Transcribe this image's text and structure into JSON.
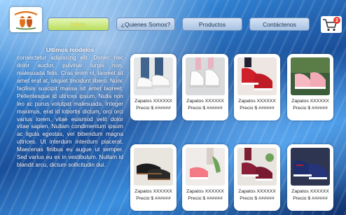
{
  "header": {
    "logo_icon": "sandal-footprint-logo",
    "nav": [
      {
        "label": "Inicio",
        "active": true
      },
      {
        "label": "¿Quienes Somos?",
        "active": false
      },
      {
        "label": "Productos",
        "active": false
      },
      {
        "label": "Contáctenos",
        "active": false
      }
    ],
    "cart": {
      "icon": "shopping-cart-icon",
      "count": "2"
    }
  },
  "about": {
    "title": "Ultimos modelos",
    "text": "consectetur adipiscing elit. Donec nec dolor auctor, pulvinar turpis non, malesuada felis. Cras enim nl, laoreet sit amet erat at, aliquet tincidunt libero. Nunc facilisis suscipit massa sit amet laoreet. Pellentesque id ultrices ipsum. Nulla non leo ac purus volutpat malesuada. Integer maximus, erat id lobortis dictum, orci orci varius lorem, vitae euismod velit dolor vitae sapien. Nullam condimentum ipsum ac ligula egestas, vel bibendum magna ultrices. Ut interdum interdum placerat. Maecenas finibus eu augue ut semper. Sed varius eu ex in vestibulum. Nullam id blandit arcu, dictum sollicitudin dui."
  },
  "products": [
    {
      "name": "Zapatos XXXXXX",
      "price": "Precio $ ######",
      "image": "white-sneakers-jeans"
    },
    {
      "name": "Zapatos XXXXXX",
      "price": "Precio $ ######",
      "image": "white-sneakers-pink"
    },
    {
      "name": "Zapatos XXXXXX",
      "price": "Precio $ ######",
      "image": "red-sneakers"
    },
    {
      "name": "Zapatos XXXXXX",
      "price": "Precio $ ######",
      "image": "pink-sneakers"
    },
    {
      "name": "Zapatos XXXXXX",
      "price": "Precio $ ######",
      "image": "black-loafers"
    },
    {
      "name": "Zapatos XXXXXX",
      "price": "Precio $ ######",
      "image": "pink-slipons"
    },
    {
      "name": "Zapatos XXXXXX",
      "price": "Precio $ ######",
      "image": "burgundy-sneakers"
    },
    {
      "name": "Zapatos XXXXXX",
      "price": "Precio $ ######",
      "image": "navy-sneakers"
    }
  ]
}
